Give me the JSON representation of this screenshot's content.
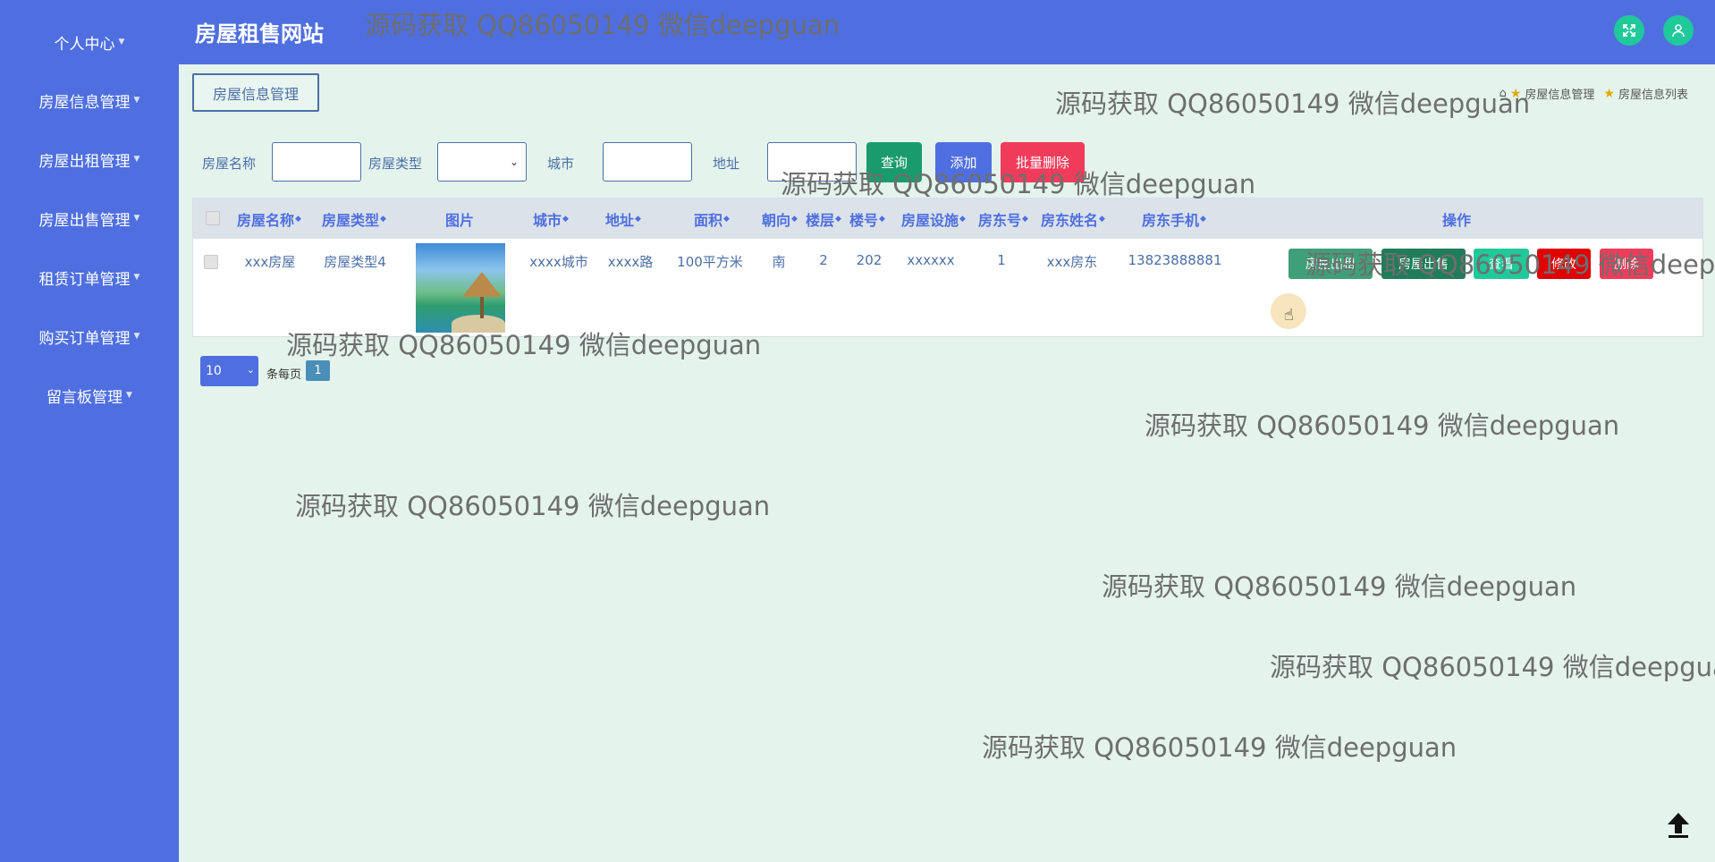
{
  "sidebar": {
    "items": [
      {
        "label": "个人中心"
      },
      {
        "label": "房屋信息管理"
      },
      {
        "label": "房屋出租管理"
      },
      {
        "label": "房屋出售管理"
      },
      {
        "label": "租赁订单管理"
      },
      {
        "label": "购买订单管理"
      },
      {
        "label": "留言板管理"
      }
    ]
  },
  "header": {
    "title": "房屋租售网站"
  },
  "page": {
    "tab_label": "房屋信息管理",
    "breadcrumb": [
      "房屋信息管理",
      "房屋信息列表"
    ]
  },
  "search": {
    "labels": {
      "name": "房屋名称",
      "type": "房屋类型",
      "city": "城市",
      "address": "地址"
    },
    "query_label": "查询",
    "add_label": "添加",
    "batch_delete_label": "批量删除"
  },
  "table": {
    "headers": [
      "房屋名称",
      "房屋类型",
      "图片",
      "城市",
      "地址",
      "面积",
      "朝向",
      "楼层",
      "楼号",
      "房屋设施",
      "房东号",
      "房东姓名",
      "房东手机",
      "操作"
    ],
    "rows": [
      {
        "name": "xxx房屋",
        "type": "房屋类型4",
        "city": "xxxx城市",
        "address": "xxxx路",
        "area": "100平方米",
        "orientation": "南",
        "floor": "2",
        "building": "202",
        "facilities": "xxxxxx",
        "landlord_no": "1",
        "landlord_name": "xxx房东",
        "landlord_phone": "13823888881"
      }
    ],
    "actions": {
      "rent": "房屋出租",
      "sell": "房屋出售",
      "view": "查看",
      "edit": "修改",
      "delete": "删除"
    }
  },
  "pagination": {
    "page_size": "10",
    "per_page_label": "条每页",
    "current_page": "1"
  },
  "watermark": "源码获取 QQ86050149 微信deepguan",
  "colors": {
    "sidebar": "#4f6fe0",
    "background": "#e5f3ed",
    "query": "#1a9b6e",
    "add": "#4f6fe0",
    "batch_delete": "#f03c5a",
    "top_icons": "#1fc99a"
  },
  "icons": [
    "fullscreen-icon",
    "user-icon",
    "home-icon",
    "star-icon",
    "upload-arrow-icon"
  ]
}
